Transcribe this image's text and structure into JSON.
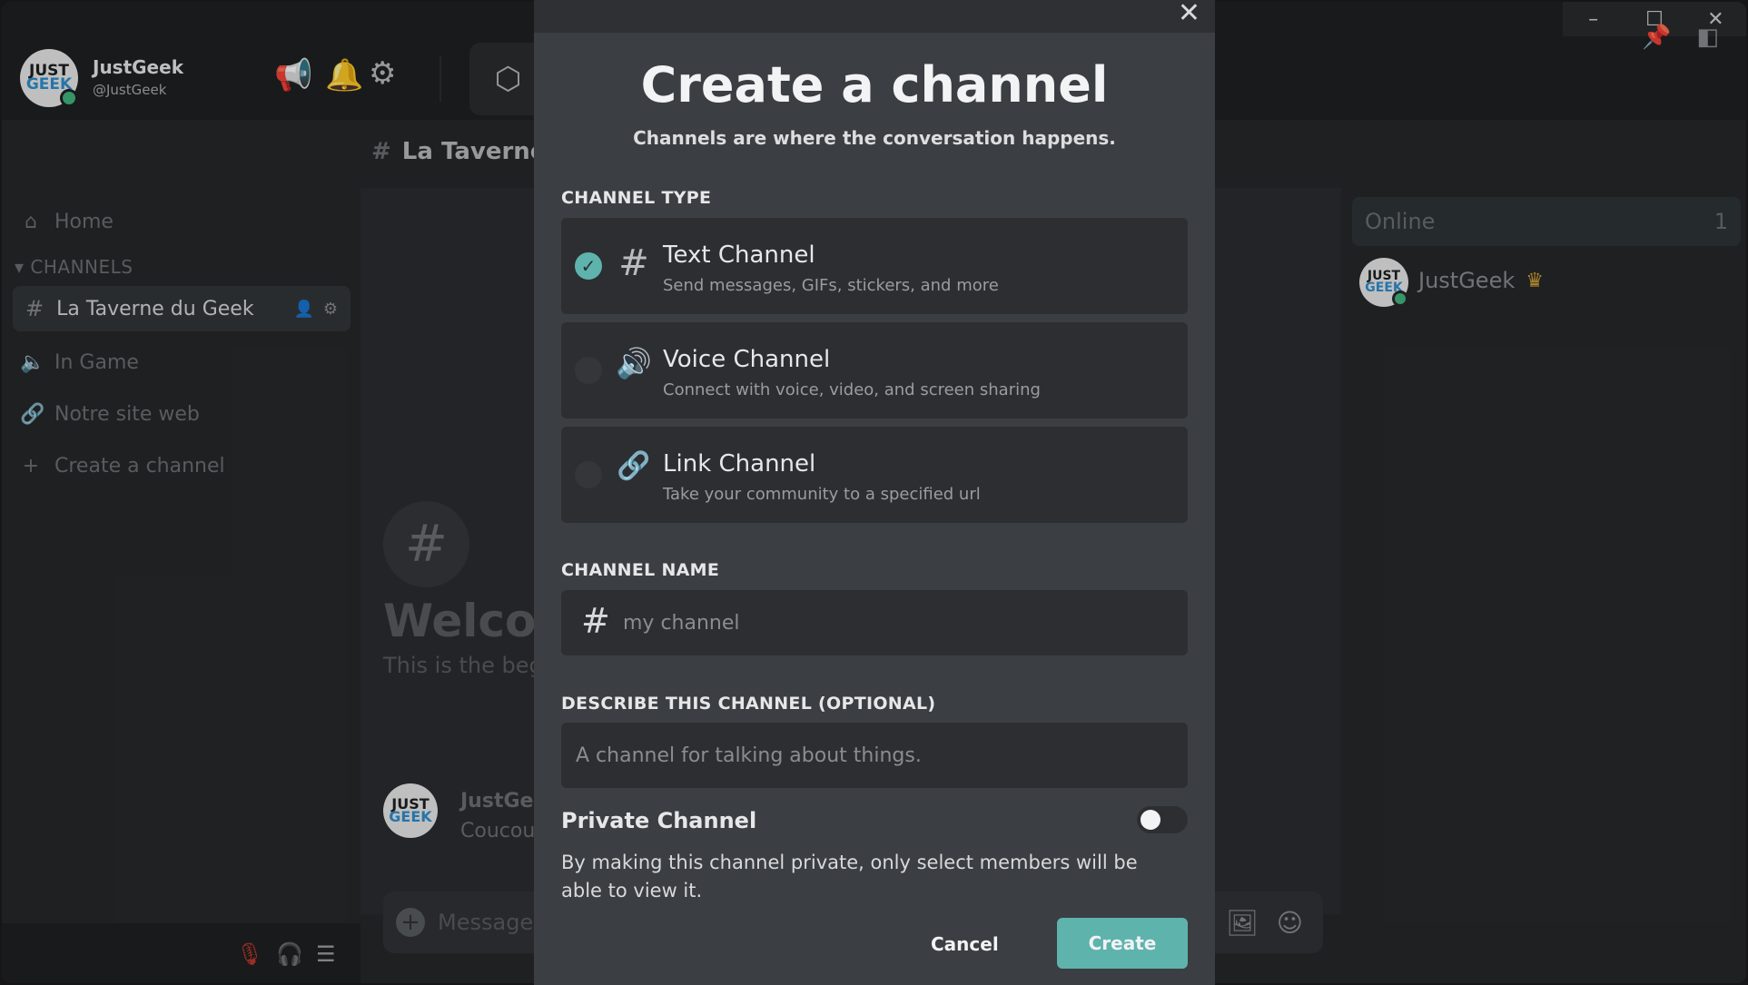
{
  "user": {
    "name": "JustGeek",
    "handle": "@JustGeek",
    "avatar_line1": "JUST",
    "avatar_line2": "GEEK"
  },
  "window_controls": {
    "minimize": "–",
    "maximize": "☐",
    "close": "✕"
  },
  "header": {
    "channel_name": "La Taverne d"
  },
  "sidebar": {
    "home": "Home",
    "section": "CHANNELS",
    "active_channel": "La Taverne du Geek",
    "items": [
      {
        "label": "In Game",
        "icon": "speaker-icon"
      },
      {
        "label": "Notre site web",
        "icon": "link-icon"
      },
      {
        "label": "Create a channel",
        "icon": "plus-icon"
      }
    ]
  },
  "main": {
    "welcome_title": "Welcor",
    "welcome_sub": "This is the beg",
    "message_author": "JustGe",
    "message_text": "Coucou",
    "input_placeholder": "Message"
  },
  "members": {
    "online_label": "Online",
    "online_count": "1",
    "member_name": "JustGeek"
  },
  "modal": {
    "close": "✕",
    "title": "Create a channel",
    "subtitle": "Channels are where the conversation happens.",
    "channel_type_label": "CHANNEL TYPE",
    "types": [
      {
        "title": "Text Channel",
        "desc": "Send messages, GIFs, stickers, and more",
        "icon": "#",
        "selected": true
      },
      {
        "title": "Voice Channel",
        "desc": "Connect with voice, video, and screen sharing",
        "icon": "🔊",
        "selected": false
      },
      {
        "title": "Link Channel",
        "desc": "Take your community to a specified url",
        "icon": "🔗",
        "selected": false
      }
    ],
    "channel_name_label": "CHANNEL NAME",
    "channel_name_placeholder": "my channel",
    "describe_label": "DESCRIBE THIS CHANNEL (OPTIONAL)",
    "describe_placeholder": "A channel for talking about things.",
    "private_title": "Private Channel",
    "private_desc": "By making this channel private, only select members will be able to view it.",
    "private_enabled": false,
    "cancel_label": "Cancel",
    "create_label": "Create"
  },
  "colors": {
    "accent": "#5eb3ad",
    "online": "#43b581",
    "crown": "#d4a437"
  }
}
